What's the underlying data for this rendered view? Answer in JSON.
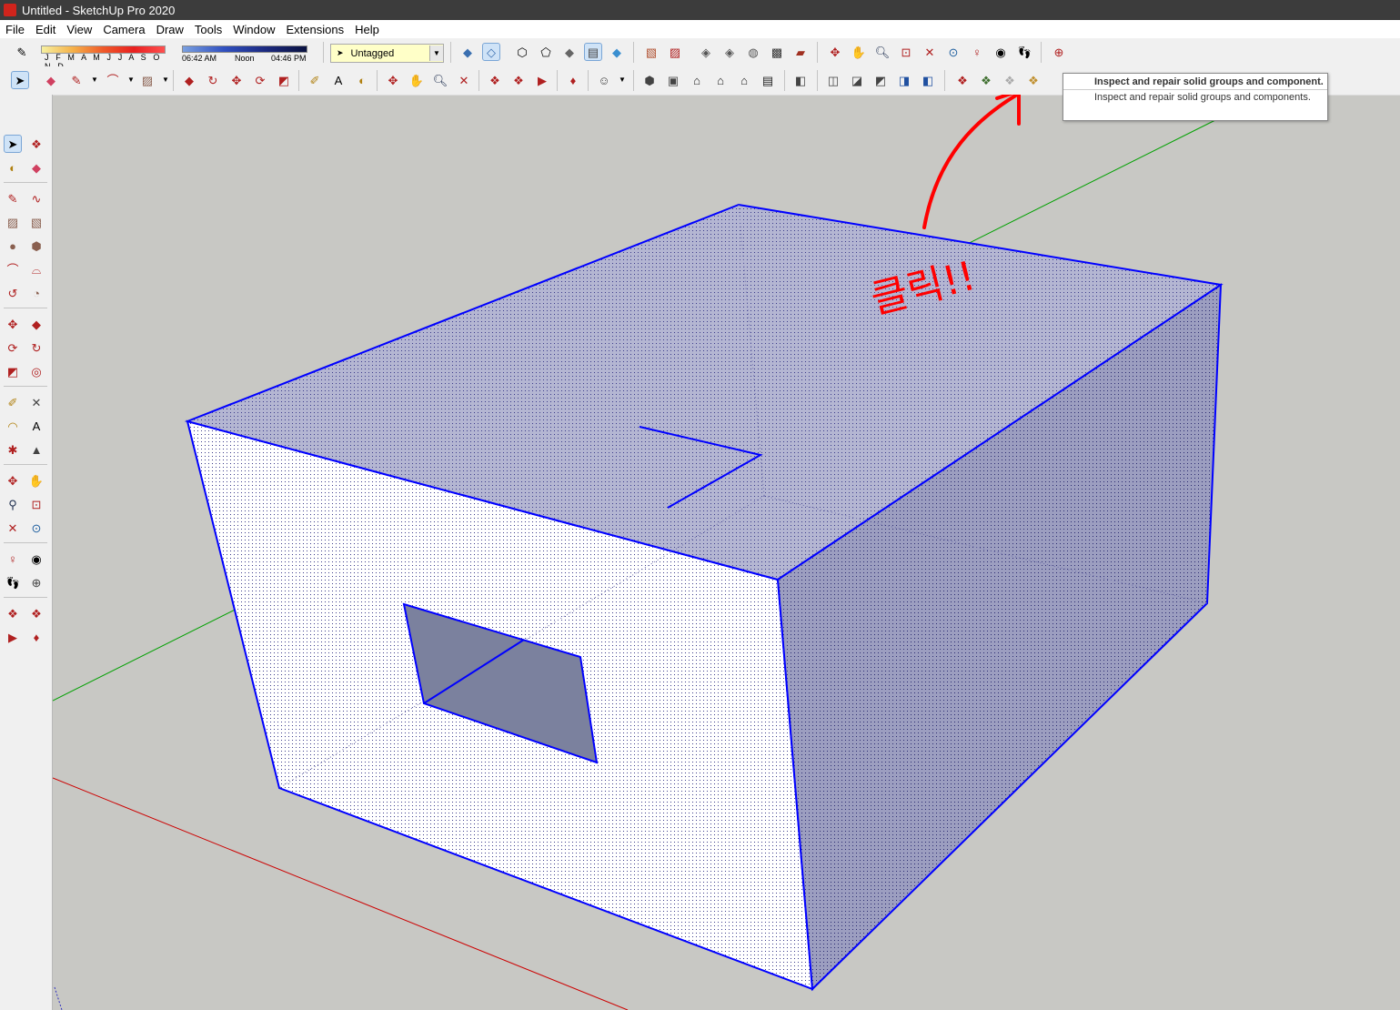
{
  "window": {
    "title": "Untitled - SketchUp Pro 2020"
  },
  "menu": [
    "File",
    "Edit",
    "View",
    "Camera",
    "Draw",
    "Tools",
    "Window",
    "Extensions",
    "Help"
  ],
  "shadow": {
    "months": "J F M A M J J A S O N D",
    "time_start": "06:42 AM",
    "time_mid": "Noon",
    "time_end": "04:46 PM"
  },
  "tag": {
    "selected": "Untagged"
  },
  "tooltip": {
    "title": "Inspect and repair solid groups and component.",
    "description": "Inspect and repair solid groups and components."
  },
  "annotation": {
    "text": "클릭!!",
    "color": "#ff0000"
  },
  "colors": {
    "selection_edge": "#0000ff",
    "face_tint": "#8c8cb4",
    "axis_red": "#cc0000",
    "axis_green": "#00a000"
  }
}
